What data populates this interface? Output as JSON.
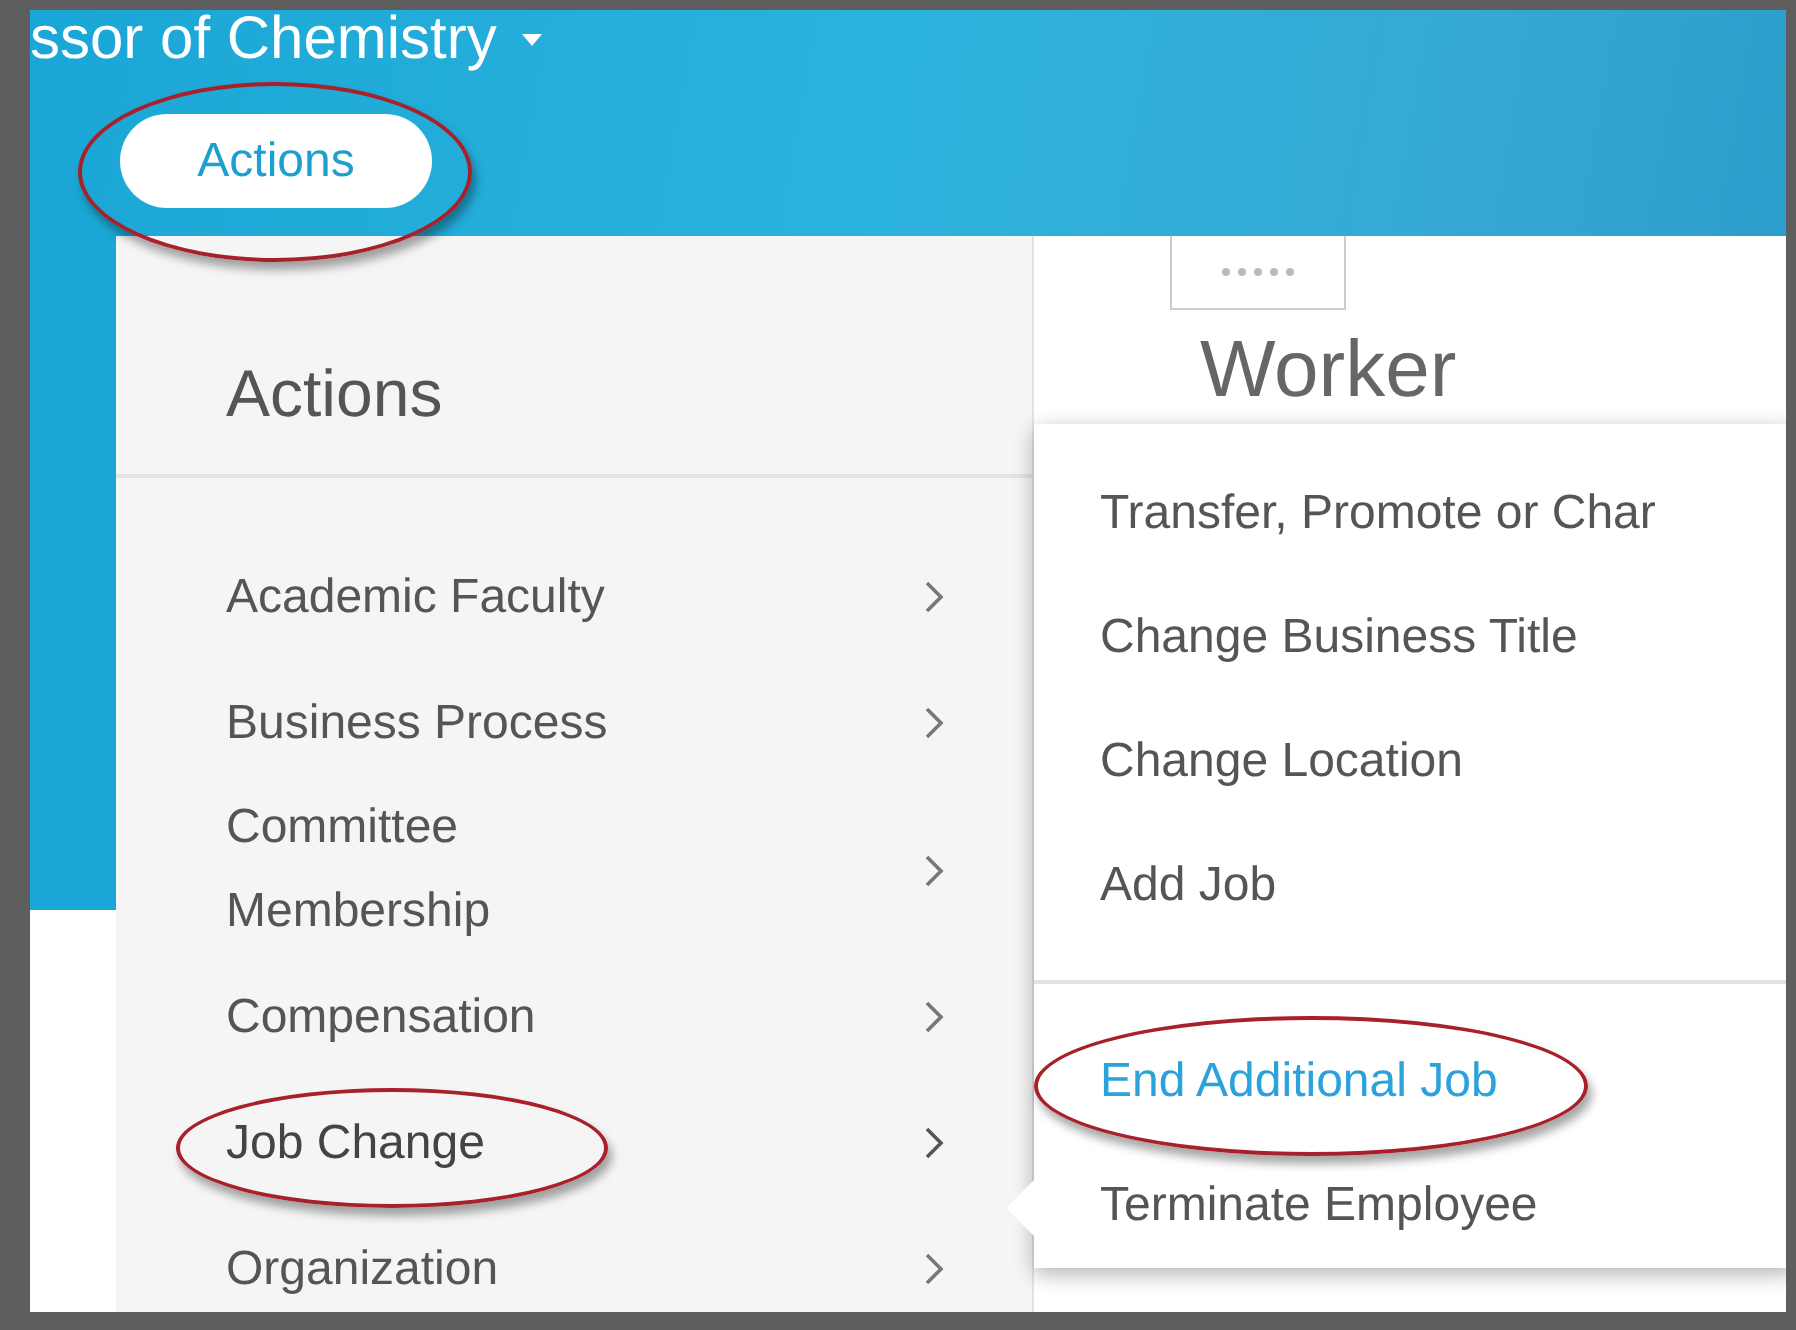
{
  "header": {
    "title": "ssor of Chemistry",
    "actions_button": {
      "label": "Actions",
      "circled": true
    }
  },
  "worker_card": {
    "title": "Worker"
  },
  "actions_menu": {
    "title": "Actions",
    "items": [
      {
        "label": "Academic Faculty",
        "selected": false,
        "circled": false
      },
      {
        "label": "Business Process",
        "selected": false,
        "circled": false
      },
      {
        "label": "Committee Membership",
        "selected": false,
        "circled": false
      },
      {
        "label": "Compensation",
        "selected": false,
        "circled": false
      },
      {
        "label": "Job Change",
        "selected": true,
        "circled": true
      },
      {
        "label": "Organization",
        "selected": false,
        "circled": false
      }
    ]
  },
  "submenu": {
    "groups": [
      [
        {
          "label": "Transfer, Promote or Char",
          "highlighted": false,
          "circled": false
        },
        {
          "label": "Change Business Title",
          "highlighted": false,
          "circled": false
        },
        {
          "label": "Change Location",
          "highlighted": false,
          "circled": false
        },
        {
          "label": "Add Job",
          "highlighted": false,
          "circled": false
        }
      ],
      [
        {
          "label": "End Additional Job",
          "highlighted": true,
          "circled": true
        },
        {
          "label": "Terminate Employee",
          "highlighted": false,
          "circled": false
        }
      ]
    ]
  }
}
